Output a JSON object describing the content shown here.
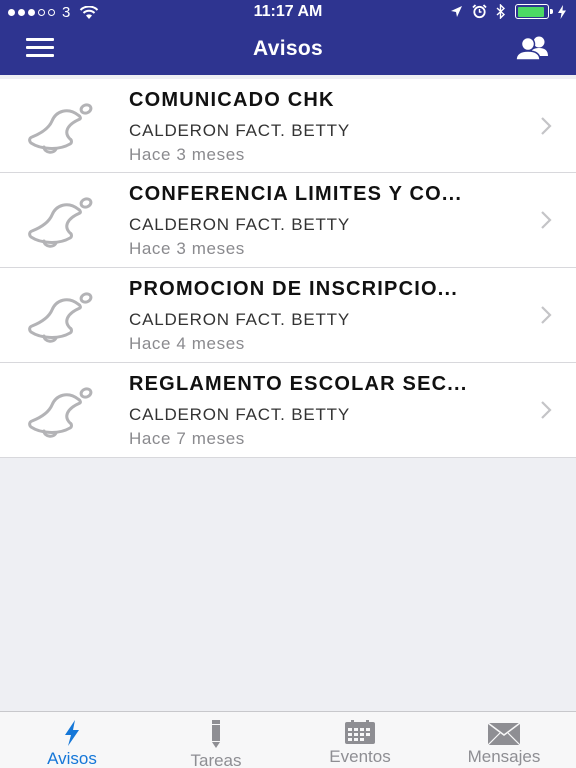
{
  "status": {
    "carrier": "3",
    "time": "11:17 AM",
    "battery_level": 0.9
  },
  "nav": {
    "title": "Avisos",
    "left_icon": "menu-icon",
    "right_icon": "users-icon"
  },
  "notices": [
    {
      "title": "COMUNICADO CHK",
      "author": "CALDERON FACT. BETTY",
      "time": "Hace 3 meses",
      "icon": "bell-icon"
    },
    {
      "title": "CONFERENCIA LIMITES Y CO...",
      "author": "CALDERON FACT. BETTY",
      "time": "Hace 3 meses",
      "icon": "bell-icon"
    },
    {
      "title": "PROMOCION DE INSCRIPCIO...",
      "author": "CALDERON FACT. BETTY",
      "time": "Hace 4 meses",
      "icon": "bell-icon"
    },
    {
      "title": "REGLAMENTO ESCOLAR SEC...",
      "author": "CALDERON FACT. BETTY",
      "time": "Hace 7 meses",
      "icon": "bell-icon"
    }
  ],
  "tabs": [
    {
      "label": "Avisos",
      "icon": "lightning-icon",
      "active": true
    },
    {
      "label": "Tareas",
      "icon": "pencil-icon",
      "active": false
    },
    {
      "label": "Eventos",
      "icon": "calendar-icon",
      "active": false
    },
    {
      "label": "Mensajes",
      "icon": "envelope-icon",
      "active": false
    }
  ],
  "colors": {
    "header": "#2e3490",
    "active_tab": "#1577d8",
    "inactive_tab": "#8e8e93",
    "battery": "#4cd964"
  }
}
